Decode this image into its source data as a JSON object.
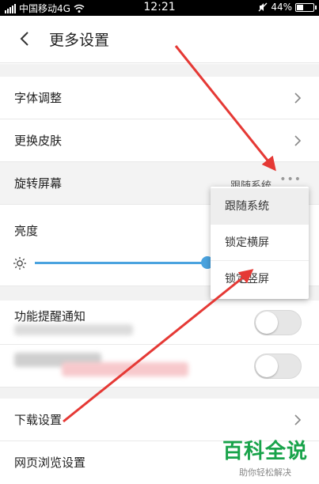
{
  "status_bar": {
    "carrier": "中国移动4G",
    "time": "12:21",
    "battery": "44%",
    "battery_level": 0.44
  },
  "header": {
    "title": "更多设置"
  },
  "settings": {
    "font": "字体调整",
    "skin": "更换皮肤",
    "rotate": {
      "label": "旋转屏幕",
      "value": "跟随系统"
    },
    "brightness": {
      "label": "亮度",
      "level": 0.55
    },
    "notify": {
      "label": "功能提醒通知",
      "on": false
    },
    "download": "下载设置",
    "browse": "网页浏览设置"
  },
  "rotation_menu": {
    "options": [
      "跟随系统",
      "锁定横屏",
      "锁定竖屏"
    ],
    "selected": 0
  },
  "watermark": {
    "main": "百科全说",
    "sub": "助你轻松解决"
  },
  "colors": {
    "accent": "#4aa3df",
    "arrow": "#e53935",
    "watermark": "#18a34a"
  }
}
